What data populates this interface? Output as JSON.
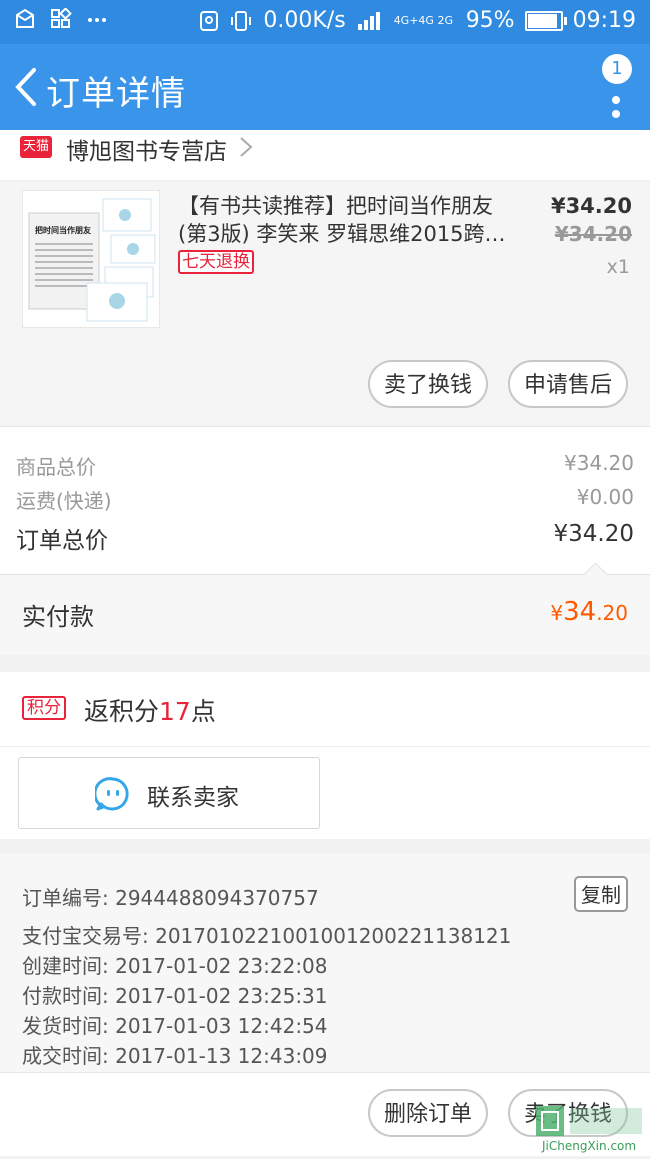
{
  "status_bar": {
    "speed": "0.00K/s",
    "network": "4G+4G 2G",
    "battery_percent": "95%",
    "battery_level": 0.95,
    "time": "09:19",
    "left_icons": [
      "message-icon",
      "apps-icon",
      "more-dots-icon"
    ],
    "right_icons": [
      "location-icon",
      "vibrate-icon",
      "signal-icon",
      "battery-icon"
    ]
  },
  "header": {
    "title": "订单详情",
    "notification_badge": "1"
  },
  "shop": {
    "logo_text": "天猫",
    "name": "博旭图书专营店"
  },
  "product": {
    "title_line1": "【有书共读推荐】把时间当作朋友",
    "title_line2": "(第3版) 李笑来 罗辑思维2015跨…",
    "tag": "七天退换",
    "price": "¥34.20",
    "original_price": "¥34.20",
    "quantity": "x1",
    "thumb_cover_text": "把时间当作朋友",
    "buttons": {
      "sell": "卖了换钱",
      "after_sale": "申请售后"
    }
  },
  "summary": {
    "goods_total_label": "商品总价",
    "goods_total_value": "¥34.20",
    "shipping_label": "运费(快递)",
    "shipping_value": "¥0.00",
    "order_total_label": "订单总价",
    "order_total_value": "¥34.20",
    "paid_label": "实付款",
    "paid_currency": "¥",
    "paid_int": "34",
    "paid_dec": ".20"
  },
  "points": {
    "badge": "积分",
    "text_prefix": "返积分",
    "value": "17",
    "text_suffix": "点"
  },
  "contact": {
    "label": "联系卖家"
  },
  "order_info": {
    "order_no": "订单编号: 2944488094370757",
    "alipay_no": "支付宝交易号: 20170102210010012002211381​21",
    "created": "创建时间: 2017-01-02 23:22:08",
    "paid": "付款时间: 2017-01-02 23:25:31",
    "shipped": "发货时间: 2017-01-03 12:42:54",
    "completed": "成交时间: 2017-01-13 12:43:09",
    "copy_label": "复制"
  },
  "bottom_bar": {
    "delete_label": "删除订单",
    "sell_label": "卖了换钱"
  },
  "watermark": {
    "text": "JiChengXin.com"
  },
  "colors": {
    "primary": "#3a95ea",
    "status_bar": "#2f8ae0",
    "tmall_red": "#e8233a",
    "price_orange": "#ff5a00"
  }
}
